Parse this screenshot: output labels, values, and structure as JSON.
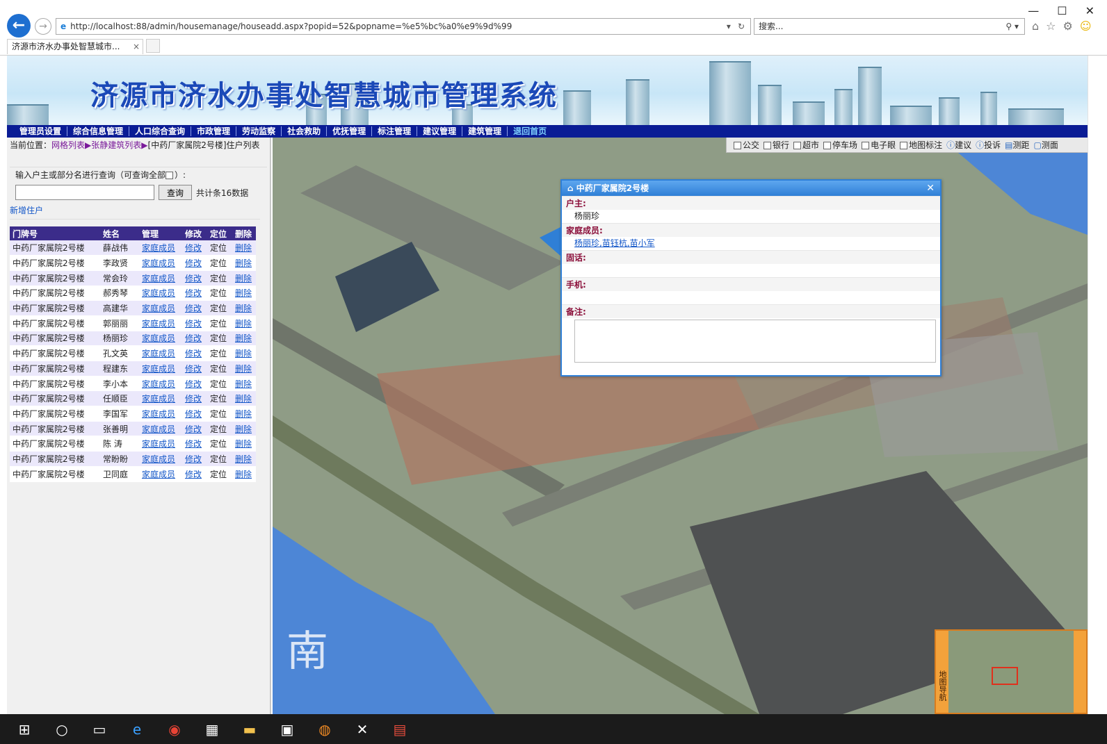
{
  "browser": {
    "url": "http://localhost:88/admin/housemanage/houseadd.aspx?popid=52&popname=%e5%bc%a0%e9%9d%99",
    "search_placeholder": "搜索...",
    "tab_title": "济源市济水办事处智慧城市...",
    "tab_close": "×"
  },
  "banner": {
    "title": "济源市济水办事处智慧城市管理系统"
  },
  "menu": [
    "管理员设置",
    "综合信息管理",
    "人口综合查询",
    "市政管理",
    "劳动监察",
    "社会救助",
    "优抚管理",
    "标注管理",
    "建议管理",
    "建筑管理",
    "退回首页"
  ],
  "left": {
    "crumb_prefix": "当前位置：",
    "crumb_link1": "网格列表",
    "crumb_sep": "▶",
    "crumb_link2": "张静建筑列表",
    "crumb_rest": "[中药厂家属院2号楼]住户列表",
    "query_label": "输入户主或部分名进行查询（可查询全部",
    "query_label_end": "）:",
    "query_button": "查询",
    "count_text": "共计条16数据",
    "add_link": "新增住户",
    "headers": [
      "门牌号",
      "姓名",
      "管理",
      "修改",
      "定位",
      "删除"
    ],
    "rows": [
      {
        "house": "中药厂家属院2号楼",
        "name": "薛战伟"
      },
      {
        "house": "中药厂家属院2号楼",
        "name": "李政贤"
      },
      {
        "house": "中药厂家属院2号楼",
        "name": "常会玲"
      },
      {
        "house": "中药厂家属院2号楼",
        "name": "郝秀琴"
      },
      {
        "house": "中药厂家属院2号楼",
        "name": "高建华"
      },
      {
        "house": "中药厂家属院2号楼",
        "name": "郭丽丽"
      },
      {
        "house": "中药厂家属院2号楼",
        "name": "杨丽珍"
      },
      {
        "house": "中药厂家属院2号楼",
        "name": "孔文英"
      },
      {
        "house": "中药厂家属院2号楼",
        "name": "程建东"
      },
      {
        "house": "中药厂家属院2号楼",
        "name": "李小本"
      },
      {
        "house": "中药厂家属院2号楼",
        "name": "任顺臣"
      },
      {
        "house": "中药厂家属院2号楼",
        "name": "李国军"
      },
      {
        "house": "中药厂家属院2号楼",
        "name": "张善明"
      },
      {
        "house": "中药厂家属院2号楼",
        "name": "陈 涛"
      },
      {
        "house": "中药厂家属院2号楼",
        "name": "常盼盼"
      },
      {
        "house": "中药厂家属院2号楼",
        "name": "卫同庭"
      }
    ],
    "cell_manage": "家庭成员",
    "cell_edit": "修改",
    "cell_locate": "定位",
    "cell_delete": "删除"
  },
  "toolbar": {
    "items": [
      "公交",
      "银行",
      "超市",
      "停车场",
      "电子眼",
      "地图标注"
    ],
    "suggest": "建议",
    "complain": "投诉",
    "measure_dist": "测距",
    "measure_area": "测面"
  },
  "popup": {
    "title": "中药厂家属院2号楼",
    "owner_label": "户主:",
    "owner": "杨丽珍",
    "members_label": "家庭成员:",
    "members": "杨丽珍,苗钰杭,苗小军",
    "phone_label": "固话:",
    "mobile_label": "手机:",
    "note_label": "备注:"
  },
  "minimap": {
    "label": "地图导航"
  },
  "colors": {
    "menubar": "#0a1c95",
    "popup_border": "#2f7fd6",
    "table_header": "#3b2c8a"
  }
}
